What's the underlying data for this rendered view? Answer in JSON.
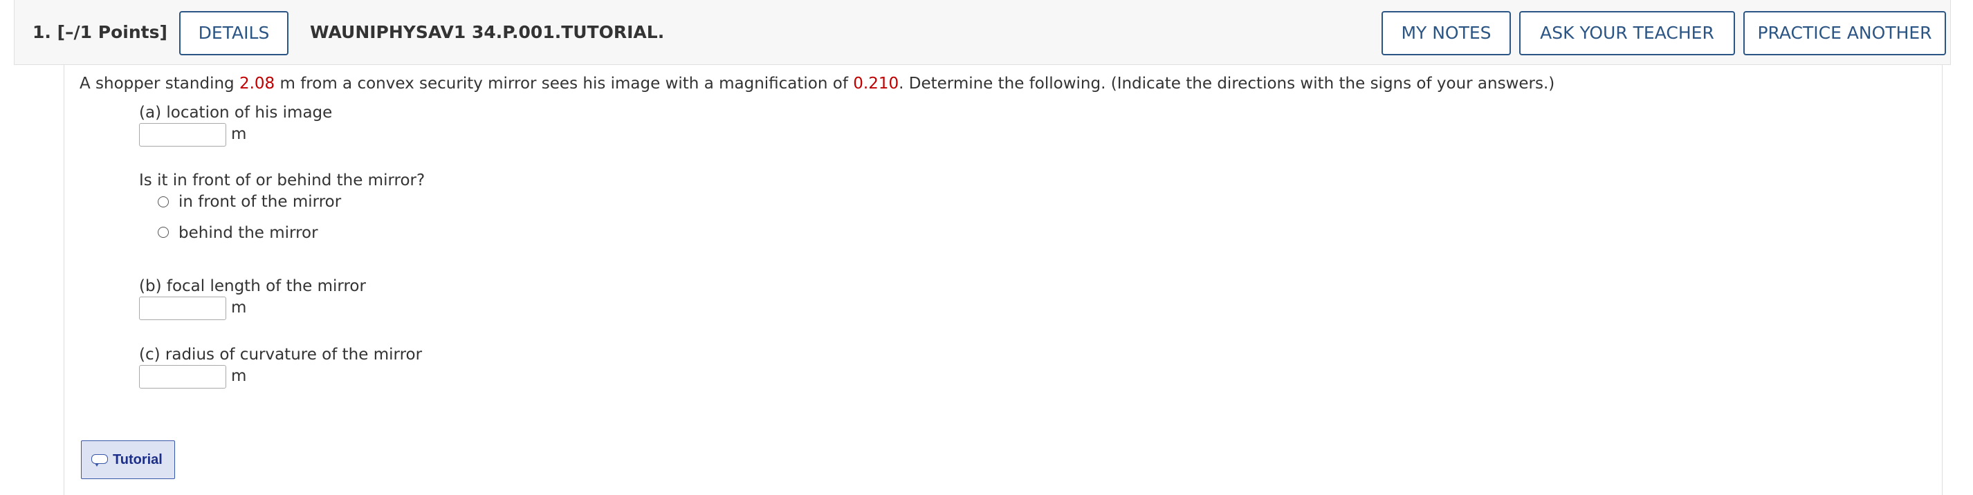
{
  "header": {
    "question_number": "1.",
    "points": "[–/1 Points]",
    "details_label": "DETAILS",
    "assignment_title": "WAUNIPHYSAV1 34.P.001.TUTORIAL.",
    "my_notes_label": "MY NOTES",
    "ask_teacher_label": "ASK YOUR TEACHER",
    "practice_another_label": "PRACTICE ANOTHER"
  },
  "question": {
    "prompt_before_distance": "A shopper standing ",
    "distance": "2.08",
    "prompt_after_distance": " m from a convex security mirror sees his image with a magnification of ",
    "magnification": "0.210",
    "prompt_end": ". Determine the following. (Indicate the directions with the signs of your answers.)",
    "highlight_color": "#c00000",
    "part_a": {
      "label": "(a) location of his image",
      "value": "",
      "unit": "m"
    },
    "direction": {
      "question": "Is it in front of or behind the mirror?",
      "options": [
        "in front of the mirror",
        "behind the mirror"
      ]
    },
    "part_b": {
      "label": "(b) focal length of the mirror",
      "value": "",
      "unit": "m"
    },
    "part_c": {
      "label": "(c) radius of curvature of the mirror",
      "value": "",
      "unit": "m"
    }
  },
  "tutorial": {
    "label": "Tutorial",
    "icon": "speech-bubble-icon"
  },
  "colors": {
    "accent": "#2b5584",
    "tutorial_text": "#1b2f8a",
    "header_bg": "#f7f7f7"
  }
}
